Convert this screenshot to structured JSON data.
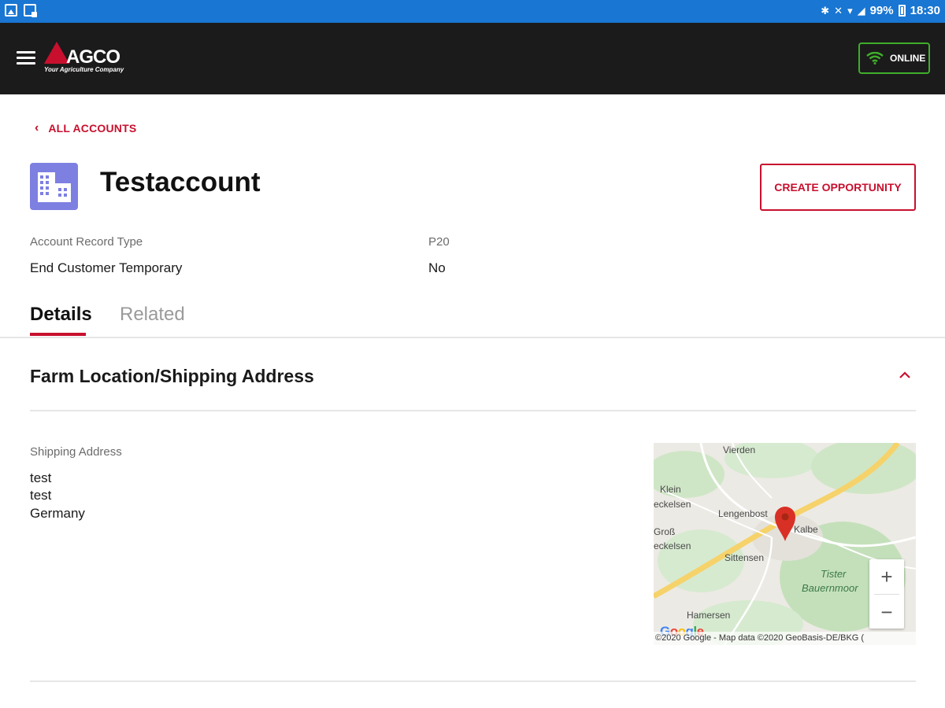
{
  "status_bar": {
    "battery": "99%",
    "time": "18:30"
  },
  "header": {
    "logo_text": "AGCO",
    "logo_tagline": "Your Agriculture Company",
    "online_label": "ONLINE"
  },
  "nav": {
    "back_label": "ALL ACCOUNTS"
  },
  "account": {
    "name": "Testaccount",
    "create_button": "CREATE OPPORTUNITY",
    "fields": [
      {
        "label": "Account Record Type",
        "value": "P20"
      },
      {
        "label": "End Customer Temporary",
        "value": "No"
      }
    ]
  },
  "tabs": [
    {
      "label": "Details",
      "active": true
    },
    {
      "label": "Related",
      "active": false
    }
  ],
  "section": {
    "title": "Farm Location/Shipping Address",
    "shipping_label": "Shipping Address",
    "address_lines": [
      "test",
      "test",
      "Germany"
    ]
  },
  "map": {
    "places": [
      "Vierden",
      "Klein",
      "eckelsen",
      "Lengenbost",
      "Kalbe",
      "Groß",
      "eckelsen",
      "Sittensen",
      "Tister",
      "Bauernmoor",
      "Hamersen"
    ],
    "zoom_in": "+",
    "zoom_out": "−",
    "google": "Google",
    "attribution": "©2020 Google - Map data ©2020 GeoBasis-DE/BKG (",
    "pin_color": "#d93025"
  },
  "colors": {
    "brand_red": "#c8102e",
    "status_blue": "#1976d2",
    "online_green": "#3fae2a",
    "account_icon": "#7d7fe1"
  },
  "icons": {
    "menu": "hamburger-menu-icon",
    "wifi": "wifi-icon",
    "back": "chevron-left-icon",
    "account": "building-icon",
    "collapse": "chevron-up-icon",
    "pin": "map-pin-icon"
  }
}
